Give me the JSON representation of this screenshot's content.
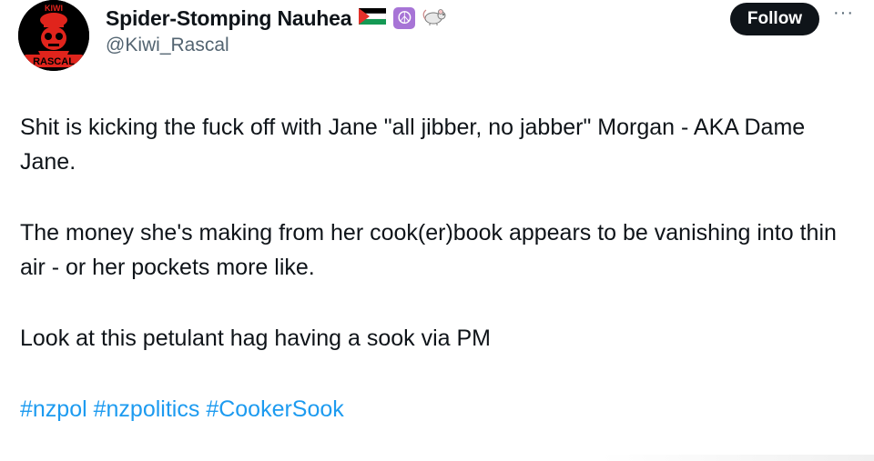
{
  "author": {
    "display_name": "Spider-Stomping Nauhea",
    "handle": "@Kiwi_Rascal",
    "avatar_text_top": "KIWI",
    "avatar_text_bottom": "RASCAL",
    "badges": [
      "palestine-flag-icon",
      "peace-sign-icon",
      "rat-icon"
    ]
  },
  "actions": {
    "follow_label": "Follow",
    "more_label": "···"
  },
  "post": {
    "paragraphs": [
      "Shit is kicking the fuck off with Jane \"all jibber, no jabber\" Morgan - AKA Dame Jane.",
      "The money she's making from her cook(er)book appears to be vanishing into thin air - or her pockets more like.",
      "Look at this petulant hag having a sook via PM"
    ],
    "hashtags": [
      "#nzpol",
      "#nzpolitics",
      "#CookerSook"
    ]
  },
  "colors": {
    "text": "#0f1419",
    "secondary": "#536471",
    "link": "#1d9bf0",
    "follow_bg": "#0f1419",
    "avatar_red": "#e0241c"
  }
}
